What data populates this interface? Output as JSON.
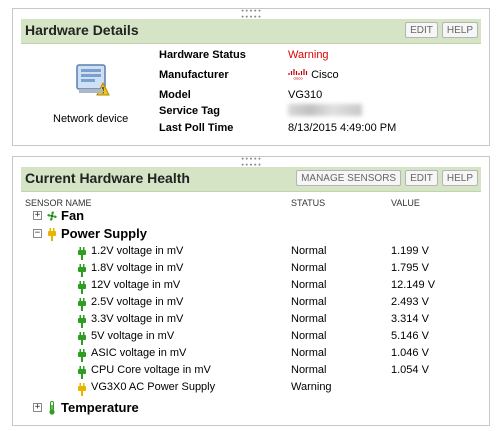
{
  "hardware_details": {
    "title": "Hardware Details",
    "edit_label": "EDIT",
    "help_label": "HELP",
    "device_label": "Network device",
    "rows": [
      {
        "label": "Hardware Status",
        "value": "Warning"
      },
      {
        "label": "Manufacturer",
        "value": "Cisco",
        "logo_text": "cisco"
      },
      {
        "label": "Model",
        "value": "VG310"
      },
      {
        "label": "Service Tag",
        "value": ""
      },
      {
        "label": "Last Poll Time",
        "value": "8/13/2015 4:49:00 PM"
      }
    ],
    "status_color": "#e00000"
  },
  "hardware_health": {
    "title": "Current Hardware Health",
    "manage_label": "MANAGE SENSORS",
    "edit_label": "EDIT",
    "help_label": "HELP",
    "columns": {
      "name": "SENSOR NAME",
      "status": "STATUS",
      "value": "VALUE"
    },
    "groups": {
      "fan": {
        "label": "Fan",
        "expander": "+",
        "icon": "fan-icon"
      },
      "power": {
        "label": "Power Supply",
        "expander": "−",
        "icon": "power-icon"
      },
      "temperature": {
        "label": "Temperature",
        "expander": "+",
        "icon": "thermometer-icon"
      }
    },
    "sensors": [
      {
        "name": "1.2V voltage in mV",
        "status": "Normal",
        "value": "1.199 V",
        "state": "ok"
      },
      {
        "name": "1.8V voltage in mV",
        "status": "Normal",
        "value": "1.795 V",
        "state": "ok"
      },
      {
        "name": "12V voltage in mV",
        "status": "Normal",
        "value": "12.149 V",
        "state": "ok"
      },
      {
        "name": "2.5V voltage in mV",
        "status": "Normal",
        "value": "2.493 V",
        "state": "ok"
      },
      {
        "name": "3.3V voltage in mV",
        "status": "Normal",
        "value": "3.314 V",
        "state": "ok"
      },
      {
        "name": "5V voltage in mV",
        "status": "Normal",
        "value": "5.146 V",
        "state": "ok"
      },
      {
        "name": "ASIC voltage in mV",
        "status": "Normal",
        "value": "1.046 V",
        "state": "ok"
      },
      {
        "name": "CPU Core voltage in mV",
        "status": "Normal",
        "value": "1.054 V",
        "state": "ok"
      },
      {
        "name": "VG3X0 AC Power Supply",
        "status": "Warning",
        "value": "",
        "state": "warning"
      }
    ],
    "colors": {
      "ok": "#2e9e22",
      "warning": "#e8b400",
      "header_bg": "#d4e4c4"
    }
  }
}
